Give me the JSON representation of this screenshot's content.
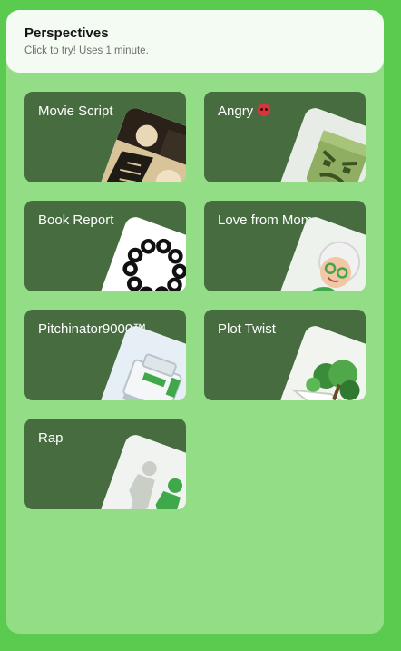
{
  "header": {
    "title": "Perspectives",
    "subtitle": "Click to try! Uses 1 minute."
  },
  "cards": [
    {
      "label": "Movie Script",
      "icon": "manga-art-icon"
    },
    {
      "label": "Angry",
      "icon": "angry-block-face-icon",
      "emoji": "angry-face-emoji"
    },
    {
      "label": "Book Report",
      "icon": "letter-ring-icon"
    },
    {
      "label": "Love from Mom",
      "icon": "grandma-figurine-icon"
    },
    {
      "label": "Pitchinator9000™",
      "icon": "machine-icon"
    },
    {
      "label": "Plot Twist",
      "icon": "pop-up-book-icon"
    },
    {
      "label": "Rap",
      "icon": "figurines-icon"
    }
  ],
  "colors": {
    "outer_background": "#5acb4f",
    "panel_background": "#93dd87",
    "card_background": "#466c40",
    "header_background": "#f4fbf3"
  }
}
